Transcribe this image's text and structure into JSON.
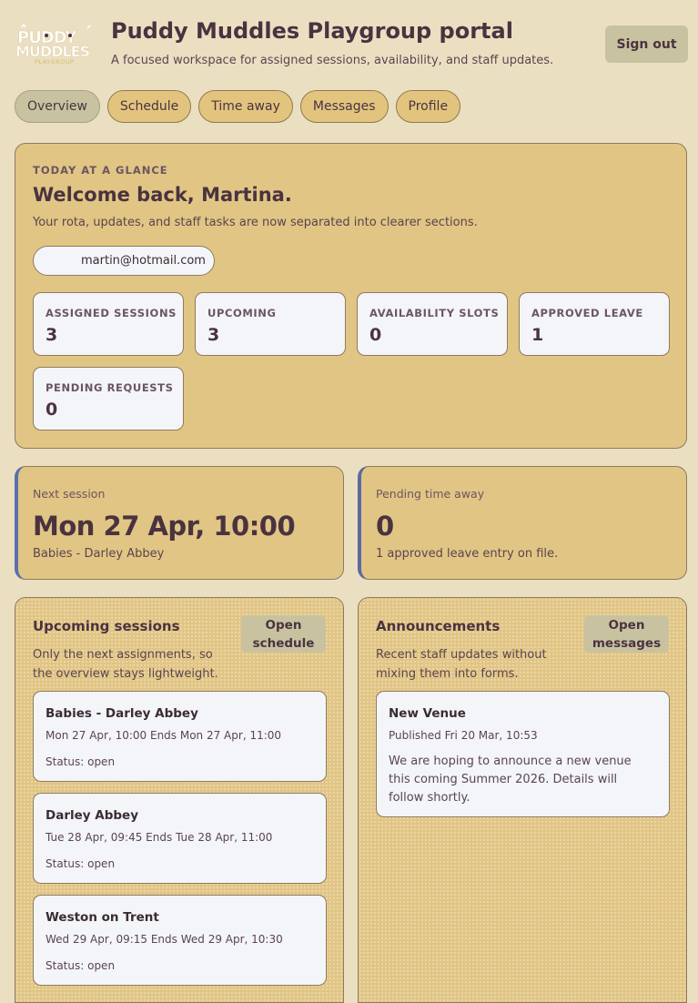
{
  "header": {
    "logo_text": "PUDDY MUDDLES",
    "logo_subtext": "PLAYGROUP",
    "title": "Puddy Muddles Playgroup portal",
    "subtitle": "A focused workspace for assigned sessions, availability, and staff updates.",
    "signout_label": "Sign out"
  },
  "tabs": [
    {
      "label": "Overview",
      "active": true
    },
    {
      "label": "Schedule"
    },
    {
      "label": "Time away"
    },
    {
      "label": "Messages"
    },
    {
      "label": "Profile"
    }
  ],
  "glance": {
    "eyebrow": "TODAY AT A GLANCE",
    "welcome": "Welcome back, Martina.",
    "description": "Your rota, updates, and staff tasks are now separated into clearer sections.",
    "email": "martin@hotmail.com",
    "stats": [
      {
        "label": "ASSIGNED SESSIONS",
        "value": "3"
      },
      {
        "label": "UPCOMING",
        "value": "3"
      },
      {
        "label": "AVAILABILITY SLOTS",
        "value": "0"
      },
      {
        "label": "APPROVED LEAVE",
        "value": "1"
      },
      {
        "label": "PENDING REQUESTS",
        "value": "0"
      }
    ]
  },
  "next_session": {
    "label": "Next session",
    "value": "Mon 27 Apr, 10:00",
    "sub": "Babies - Darley Abbey"
  },
  "pending_time_away": {
    "label": "Pending time away",
    "value": "0",
    "sub": "1 approved leave entry on file."
  },
  "upcoming": {
    "title": "Upcoming sessions",
    "description": "Only the next assignments, so the overview stays lightweight.",
    "button_label": "Open schedule",
    "sessions": [
      {
        "title": "Babies - Darley Abbey",
        "times": "Mon 27 Apr, 10:00   Ends Mon 27 Apr, 11:00",
        "status": "Status: open"
      },
      {
        "title": "Darley Abbey",
        "times": "Tue 28 Apr, 09:45   Ends Tue 28 Apr, 11:00",
        "status": "Status: open"
      },
      {
        "title": "Weston on Trent",
        "times": "Wed 29 Apr, 09:15   Ends Wed 29 Apr, 10:30",
        "status": "Status: open"
      }
    ]
  },
  "announcements": {
    "title": "Announcements",
    "description": "Recent staff updates without mixing them into forms.",
    "button_label": "Open messages",
    "items": [
      {
        "title": "New Venue",
        "meta": "Published Fri 20 Mar, 10:53",
        "body": "We are hoping to announce a new venue this coming Summer 2026. Details will follow shortly."
      }
    ]
  },
  "colors": {
    "page_bg": "#ebdfc2",
    "panel_bg": "#e1c584",
    "card_bg": "#f3f5f9",
    "accent_button": "#c9c2a0",
    "side_accent": "#5b6fae",
    "text": "#4a3340"
  }
}
